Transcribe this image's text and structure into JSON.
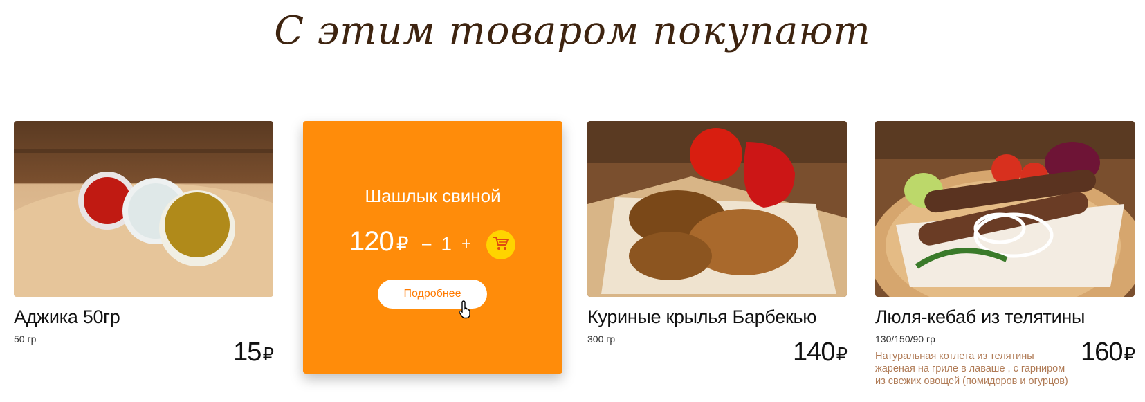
{
  "heading": "С этим товаром покупают",
  "products": [
    {
      "name": "Аджика 50гр",
      "weight": "50 гр",
      "price": "15",
      "currency": "₽",
      "description": ""
    },
    {
      "name": "Куриные крылья Барбекью",
      "weight": "300 гр",
      "price": "140",
      "currency": "₽",
      "description": ""
    },
    {
      "name": "Люля-кебаб из телятины",
      "weight": "130/150/90 гр",
      "price": "160",
      "currency": "₽",
      "description": "Натуральная котлета из телятины жареная на гриле в лаваше , с гарниром из свежих овощей (помидоров и огурцов)"
    }
  ],
  "hover_card": {
    "name": "Шашлык свиной",
    "price": "120",
    "currency": "₽",
    "minus": "–",
    "quantity": "1",
    "plus": "+",
    "details_label": "Подробнее",
    "cart_icon": "cart-icon",
    "color": "#ff8c0a",
    "cart_color": "#ffd400"
  }
}
